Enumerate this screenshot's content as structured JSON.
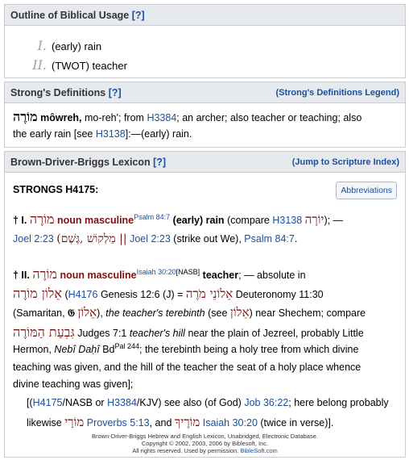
{
  "outline": {
    "title": "Outline of Biblical Usage",
    "q": "[?]",
    "items": [
      {
        "num": "I.",
        "text": "(early) rain"
      },
      {
        "num": "II.",
        "text": "(TWOT) teacher"
      }
    ]
  },
  "strongs": {
    "title": "Strong's Definitions",
    "q": "[?]",
    "legend": "(Strong's Definitions Legend)",
    "heb": "מוֹרֶה",
    "translit": "môwreh,",
    "pron": "mo-reh';",
    "from": "from",
    "ref1": "H3384",
    "rest1": "; an archer; also teacher or teaching; also",
    "line2a": "the early rain [see",
    "ref2": "H3138",
    "line2b": "]:—(early) rain."
  },
  "bdb": {
    "title": "Brown-Driver-Briggs Lexicon",
    "q": "[?]",
    "jump": "(Jump to Scripture Index)",
    "strongs_label": "STRONGS H4175:",
    "abbrev_button": "Abbreviations",
    "e1_dagger": "† I.",
    "e1_heb": "מוֹרֶה",
    "e1_pos": "noun masculine",
    "e1_sup": "Psalm 84:7",
    "e1_gloss": "(early) rain",
    "e1_compare": "(compare",
    "e1_ref": "H3138",
    "e1_heb2": "יוֹרֶה",
    "e1_end": "); —",
    "e1_l2_ref1": "Joel 2:23",
    "e1_l2_heb": "(מַלְקוֹשׁ ,גֶּשֶׁם ||",
    "e1_l2_ref2": "Joel 2:23",
    "e1_l2_mid": "(strike out We),",
    "e1_l2_ref3": "Psalm 84:7",
    "e1_l2_end": ".",
    "e2_dagger": "† II.",
    "e2_heb": "מוֹרֶה",
    "e2_pos": "noun masculine",
    "e2_sup": "Isaiah 30:20",
    "e2_sup2": "[NASB]",
    "e2_gloss": "teacher",
    "e2_rest": "; — absolute in",
    "e2_l2_heb": "אֵלוֹן מוֹרֶה",
    "e2_l2_ref": "H4176",
    "e2_l2_a": "Genesis 12:6 (J) =",
    "e2_l2_heb2": "אֵלוֹנֵי מֹרֶה",
    "e2_l2_b": "Deuteronomy 11:30",
    "e2_l3_a": "(Samaritan,",
    "e2_l3_g": "𝔊",
    "e2_l3_heb": "אֵלוֹן",
    "e2_l3_b": "),",
    "e2_l3_i": "the teacher's terebinth",
    "e2_l3_c": "(see",
    "e2_l3_heb2": "אֵלוֹן",
    "e2_l3_d": ") near Shechem; compare",
    "e2_l4_heb": "גִּבְעַת הַמּוֹרֶה",
    "e2_l4_a": "Judges 7:1",
    "e2_l4_i": "teacher's hill",
    "e2_l4_b": "near the plain of Jezreel, probably Little",
    "e2_l5_a": "Hermon,",
    "e2_l5_i": "Nebî Daḥî",
    "e2_l5_b": "Bd",
    "e2_l5_sup": "Pal 244",
    "e2_l5_c": "; the terebinth being a holy tree from which divine",
    "e2_l6": "teaching was given, and the hill of the teacher the seat of a holy place whence",
    "e2_l7": "divine teaching was given];",
    "n_l1_a": "[(",
    "n_ref1": "H4175",
    "n_l1_b": "/NASB or",
    "n_ref2": "H3384",
    "n_l1_c": "/KJV) see also (of God)",
    "n_ref3": "Job 36:22",
    "n_l1_d": "; here belong probably",
    "n_l2_a": "likewise",
    "n_l2_heb": "מוֹרָי",
    "n_ref4": "Proverbs 5:13",
    "n_l2_b": ", and",
    "n_l2_heb2": "מוֹרֶיךָ",
    "n_ref5": "Isaiah 30:20",
    "n_l2_c": "(twice in verse)].",
    "foot1": "Brown-Driver-Briggs Hebrew and English Lexicon, Unabridged, Electronic Database.",
    "foot2": "Copyright © 2002, 2003, 2006 by Biblesoft, Inc.",
    "foot3a": "All rights reserved. Used by permission.",
    "foot3b": "BibleSoft.com"
  }
}
